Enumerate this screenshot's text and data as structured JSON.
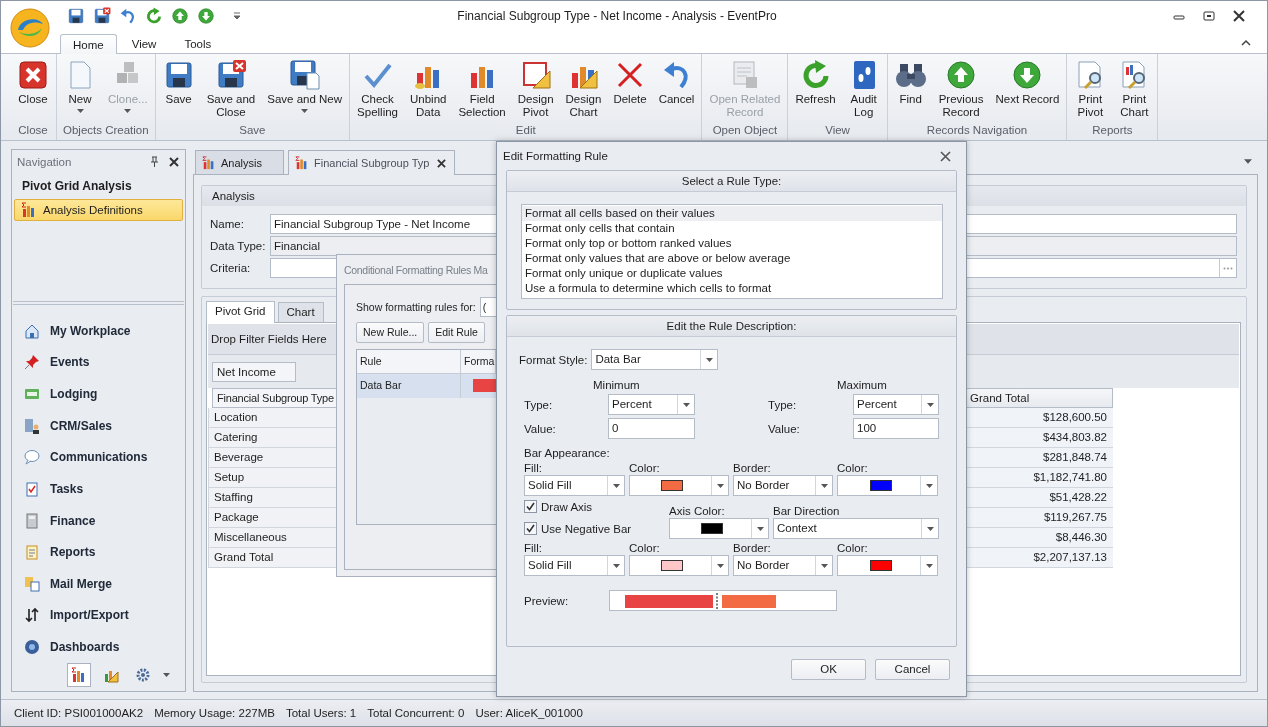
{
  "window": {
    "title": "Financial Subgroup Type - Net Income - Analysis - EventPro"
  },
  "ribbon": {
    "tabs": [
      {
        "label": "Home",
        "selected": true
      },
      {
        "label": "View",
        "selected": false
      },
      {
        "label": "Tools",
        "selected": false
      }
    ],
    "groups": [
      {
        "label": "Close",
        "buttons": [
          {
            "label": "Close",
            "disabled": false,
            "dropdown": false
          }
        ]
      },
      {
        "label": "Objects Creation",
        "buttons": [
          {
            "label": "New",
            "disabled": false,
            "dropdown": true
          },
          {
            "label": "Clone...",
            "disabled": true,
            "dropdown": true
          }
        ]
      },
      {
        "label": "Save",
        "buttons": [
          {
            "label": "Save",
            "disabled": false,
            "dropdown": false
          },
          {
            "label": "Save and\nClose",
            "disabled": false,
            "dropdown": false
          },
          {
            "label": "Save and New",
            "disabled": false,
            "dropdown": true
          }
        ]
      },
      {
        "label": "Edit",
        "buttons": [
          {
            "label": "Check\nSpelling",
            "disabled": false,
            "dropdown": false
          },
          {
            "label": "Unbind\nData",
            "disabled": false,
            "dropdown": false
          },
          {
            "label": "Field\nSelection",
            "disabled": false,
            "dropdown": false
          },
          {
            "label": "Design\nPivot",
            "disabled": false,
            "dropdown": false
          },
          {
            "label": "Design\nChart",
            "disabled": false,
            "dropdown": false
          },
          {
            "label": "Delete",
            "disabled": false,
            "dropdown": false
          },
          {
            "label": "Cancel",
            "disabled": false,
            "dropdown": false
          }
        ]
      },
      {
        "label": "Open Object",
        "buttons": [
          {
            "label": "Open Related\nRecord",
            "disabled": true,
            "dropdown": false
          }
        ]
      },
      {
        "label": "View",
        "buttons": [
          {
            "label": "Refresh",
            "disabled": false,
            "dropdown": false
          },
          {
            "label": "Audit\nLog",
            "disabled": false,
            "dropdown": false
          }
        ]
      },
      {
        "label": "Records Navigation",
        "buttons": [
          {
            "label": "Find",
            "disabled": false,
            "dropdown": false
          },
          {
            "label": "Previous\nRecord",
            "disabled": false,
            "dropdown": false
          },
          {
            "label": "Next Record",
            "disabled": false,
            "dropdown": false
          }
        ]
      },
      {
        "label": "Reports",
        "buttons": [
          {
            "label": "Print\nPivot",
            "disabled": false,
            "dropdown": false
          },
          {
            "label": "Print\nChart",
            "disabled": false,
            "dropdown": false
          }
        ]
      }
    ]
  },
  "navigation": {
    "title": "Navigation",
    "section": "Pivot Grid Analysis",
    "items": [
      {
        "label": "Analysis Definitions",
        "selected": true
      }
    ],
    "modules": [
      {
        "label": "My Workplace"
      },
      {
        "label": "Events"
      },
      {
        "label": "Lodging"
      },
      {
        "label": "CRM/Sales"
      },
      {
        "label": "Communications"
      },
      {
        "label": "Tasks"
      },
      {
        "label": "Finance"
      },
      {
        "label": "Reports"
      },
      {
        "label": "Mail Merge"
      },
      {
        "label": "Import/Export"
      },
      {
        "label": "Dashboards"
      }
    ],
    "shortcuts": [
      {
        "selected": true
      },
      {
        "selected": false
      },
      {
        "selected": false
      }
    ]
  },
  "documents": {
    "tabs": [
      {
        "label": "Analysis",
        "selected": false,
        "closable": false
      },
      {
        "label": "Financial Subgroup Typ",
        "selected": true,
        "closable": true
      }
    ]
  },
  "analysis": {
    "title": "Analysis",
    "fields": [
      {
        "label": "Name:",
        "value": "Financial Subgroup Type - Net Income",
        "readonly": false
      },
      {
        "label": "Data Type:",
        "value": "Financial",
        "readonly": true
      },
      {
        "label": "Criteria:",
        "readonly": false,
        "kind": "browse"
      }
    ]
  },
  "pivot": {
    "tabs": [
      {
        "label": "Pivot Grid",
        "selected": true
      },
      {
        "label": "Chart",
        "selected": false
      }
    ],
    "filter_area": "Drop Filter Fields Here",
    "data_field": "Net Income",
    "row_field": "Financial Subgroup Type",
    "column_header": "Grand Total",
    "rows": [
      {
        "label": "Location",
        "total": "$128,600.50"
      },
      {
        "label": "Catering",
        "total": "$434,803.82"
      },
      {
        "label": "Beverage",
        "total": "$281,848.74"
      },
      {
        "label": "Setup",
        "total": "$1,182,741.80"
      },
      {
        "label": "Staffing",
        "total": "$51,428.22"
      },
      {
        "label": "Package",
        "total": "$119,267.75"
      },
      {
        "label": "Miscellaneous",
        "total": "$8,446.30"
      },
      {
        "label": "Grand Total",
        "total": "$2,207,137.13"
      }
    ]
  },
  "rules_manager": {
    "title": "Conditional Formatting Rules Ma",
    "show_label": "Show formatting rules for:",
    "show_value": "(",
    "buttons": [
      "New Rule...",
      "Edit Rule"
    ],
    "columns": [
      "Rule",
      "Forma"
    ],
    "rows": [
      {
        "rule": "Data Bar",
        "selected": true,
        "color": "#e84444"
      }
    ]
  },
  "edit_rule": {
    "title": "Edit Formatting Rule",
    "rule_type_header": "Select a Rule Type:",
    "rule_types": [
      {
        "label": "Format all cells based on their values",
        "selected": true
      },
      {
        "label": "Format only cells that contain",
        "selected": false
      },
      {
        "label": "Format only top or bottom ranked values",
        "selected": false
      },
      {
        "label": "Format only values that are above or below average",
        "selected": false
      },
      {
        "label": "Format only unique or duplicate values",
        "selected": false
      },
      {
        "label": "Use a formula to determine which cells to format",
        "selected": false
      }
    ],
    "description_header": "Edit the Rule Description:",
    "format_style": {
      "label": "Format Style:",
      "value": "Data Bar"
    },
    "minimum": {
      "heading": "Minimum",
      "type_label": "Type:",
      "type": "Percent",
      "value_label": "Value:",
      "value": "0"
    },
    "maximum": {
      "heading": "Maximum",
      "type_label": "Type:",
      "type": "Percent",
      "value_label": "Value:",
      "value": "100"
    },
    "bar_appearance": "Bar Appearance:",
    "positive": {
      "fill_label": "Fill:",
      "fill": "Solid Fill",
      "color_label": "Color:",
      "color": "#f26b43",
      "border_label": "Border:",
      "border": "No Border",
      "border_color_label": "Color:",
      "border_swatch": {
        "color": "#0000ff"
      }
    },
    "draw_axis": {
      "label": "Draw Axis",
      "checked": true
    },
    "negative_bar": {
      "label": "Use Negative Bar",
      "checked": true
    },
    "axis_color": {
      "label": "Axis Color:",
      "color": "#000000"
    },
    "bar_direction": {
      "label": "Bar Direction",
      "value": "Context"
    },
    "negative": {
      "fill_label": "Fill:",
      "fill": "Solid Fill",
      "color_label": "Color:",
      "color": "#ffc7c7",
      "border_label": "Border:",
      "border": "No Border",
      "border_color_label": "Color:",
      "border_swatch": {
        "color": "#ff0000"
      }
    },
    "preview": {
      "label": "Preview:",
      "bars": [
        {
          "color": "#e84444"
        },
        {
          "color": "#f26b43"
        }
      ]
    },
    "buttons": [
      "OK",
      "Cancel"
    ]
  },
  "status_bar": [
    "Client ID: PSI001000AK2",
    "Memory Usage: 227MB",
    "Total Users: 1",
    "Total Concurrent: 0",
    "User: AliceK_001000"
  ]
}
